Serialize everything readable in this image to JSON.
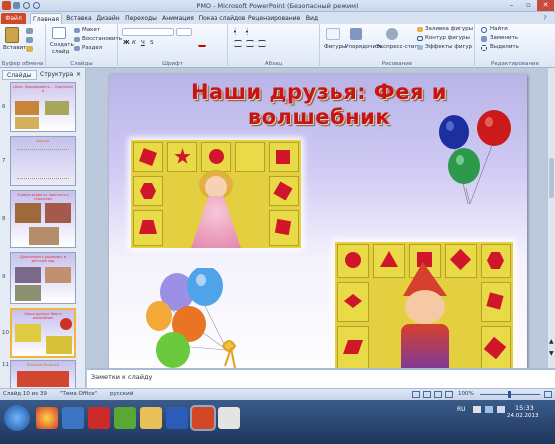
{
  "window": {
    "title": "PMO - Microsoft PowerPoint (Безопасный режим)"
  },
  "tabs": [
    "Файл",
    "Главная",
    "Вставка",
    "Дизайн",
    "Переходы",
    "Анимация",
    "Показ слайдов",
    "Рецензирование",
    "Вид"
  ],
  "ribbon": {
    "clipboard": {
      "label": "Буфер обмена",
      "paste": "Вставить"
    },
    "slides": {
      "label": "Слайды",
      "new_slide_1": "Создать",
      "new_slide_2": "слайд",
      "layout": "Макет",
      "reset": "Восстановить",
      "section": "Раздел"
    },
    "font": {
      "label": "Шрифт"
    },
    "paragraph": {
      "label": "Абзац"
    },
    "drawing": {
      "label": "Рисование",
      "shapes": "Фигуры",
      "arrange": "Упорядочить",
      "quick_styles": "Экспресс-стили",
      "fill": "Заливка фигуры",
      "outline": "Контур фигуры",
      "effects": "Эффекты фигур"
    },
    "editing": {
      "label": "Редактирование",
      "find": "Найти",
      "replace": "Заменить",
      "select": "Выделить"
    }
  },
  "pane": {
    "tab_slides": "Слайды",
    "tab_outline": "Структура",
    "thumbs": [
      {
        "num": "6",
        "title": "Цель: Формировать ... Карточки и"
      },
      {
        "num": "7",
        "title": "Задачи:"
      },
      {
        "num": "8",
        "title": "Учимся играя от простого к сложному"
      },
      {
        "num": "9",
        "title": "Дополняем с родными, в детский сад"
      },
      {
        "num": "10",
        "title": "Наши друзья: Фея и волшебник"
      },
      {
        "num": "11",
        "title": "Весёлые бусинки"
      }
    ]
  },
  "slide": {
    "title": "Наши друзья: Фея и волшебник"
  },
  "notes": {
    "placeholder": "Заметки к слайду"
  },
  "status": {
    "slide_counter": "Слайд 10 из 39",
    "theme": "\"Тема Office\"",
    "language": "русский",
    "zoom": "100%"
  },
  "tray": {
    "lang": "RU",
    "time": "15:33",
    "date": "24.02.2013"
  },
  "colors": {
    "title_red": "#c81414",
    "file_tab": "#d24726",
    "accent": "#2b579a"
  }
}
